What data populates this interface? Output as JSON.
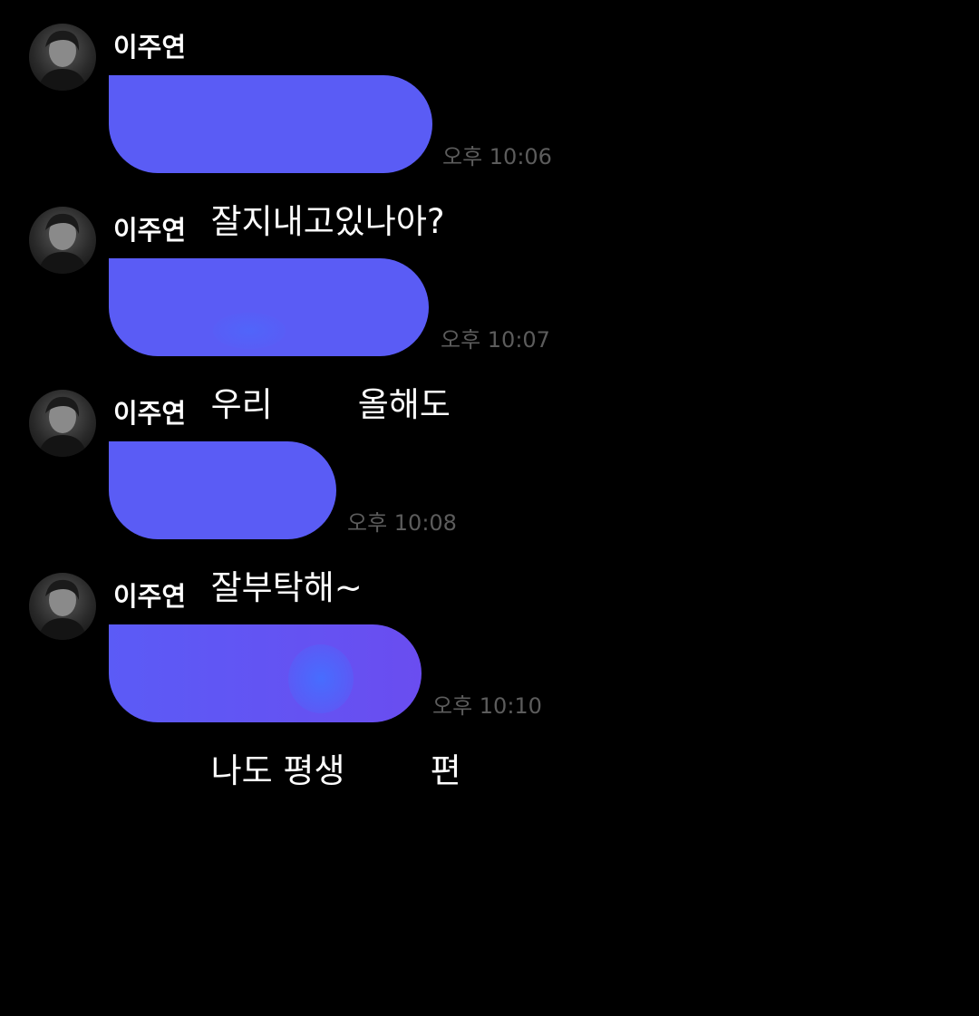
{
  "messages": [
    {
      "sender": "이주연",
      "text": "잘지내고있나아?",
      "time": "오후 10:06"
    },
    {
      "sender": "이주연",
      "text": "우리        올해도",
      "time": "오후 10:07"
    },
    {
      "sender": "이주연",
      "text": "잘부탁해~",
      "time": "오후 10:08"
    },
    {
      "sender": "이주연",
      "text": "나도 평생        편",
      "time": "오후 10:10"
    }
  ],
  "colors": {
    "background": "#000000",
    "bubble": "#5a5cf5",
    "sender_name": "#ffffff",
    "timestamp": "#5c5c5c"
  },
  "icons": {
    "avatar": "profile-photo"
  }
}
